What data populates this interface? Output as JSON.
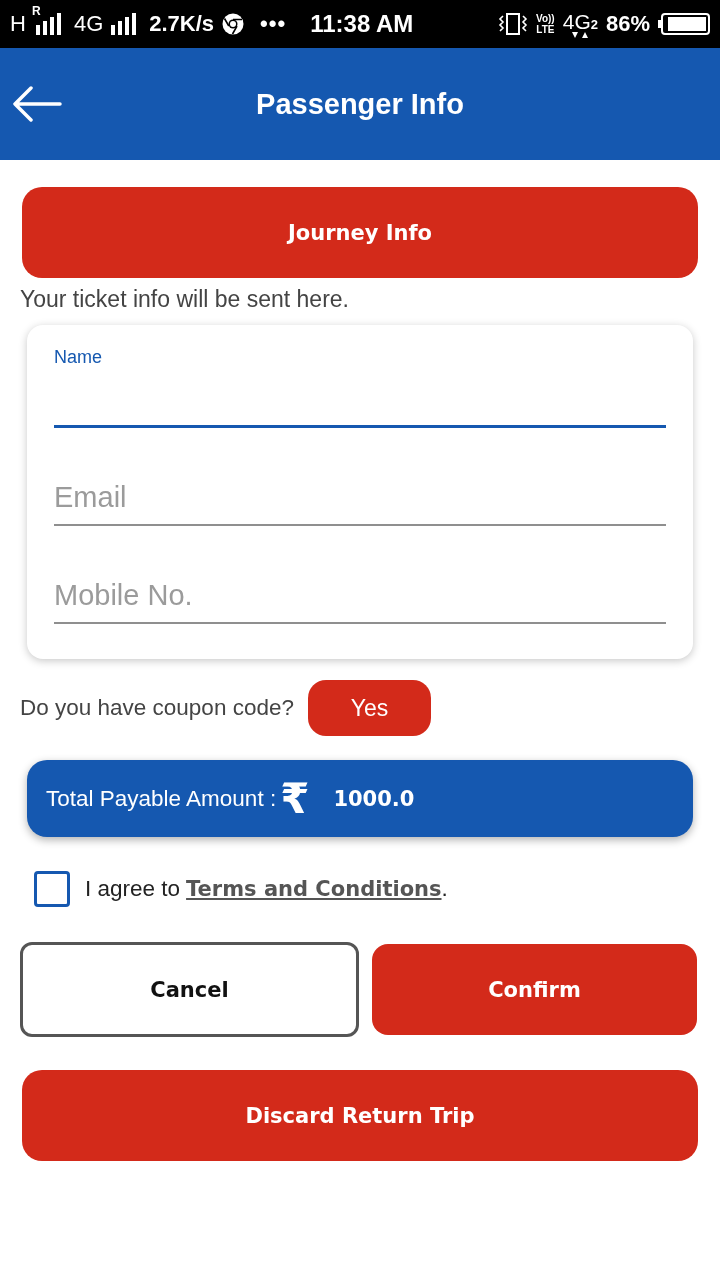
{
  "status_bar": {
    "network_1": "H",
    "roaming": "R",
    "network_2": "4G",
    "speed": "2.7K/s",
    "more": "•••",
    "time": "11:38 AM",
    "volte_top": "Vo))",
    "volte_bottom": "LTE",
    "network_3": "4G",
    "sim": "2",
    "battery": "86%"
  },
  "header": {
    "title": "Passenger Info"
  },
  "journey_button": "Journey Info",
  "note": "Your ticket info will be sent here.",
  "form": {
    "fields": [
      {
        "label": "Name",
        "focused": true
      },
      {
        "placeholder": "Email",
        "focused": false
      },
      {
        "placeholder": "Mobile No.",
        "focused": false
      }
    ]
  },
  "coupon": {
    "question": "Do you have coupon code?",
    "button": "Yes"
  },
  "total": {
    "label": "Total Payable Amount :",
    "currency": "₹",
    "amount": "1000.0"
  },
  "agreement": {
    "checked": false,
    "prefix": "I agree to",
    "link": "Terms and Conditions",
    "suffix": "."
  },
  "actions": [
    {
      "label": "Cancel",
      "kind": "outline"
    },
    {
      "label": "Confirm",
      "kind": "filled"
    }
  ],
  "discard_button": "Discard Return Trip"
}
